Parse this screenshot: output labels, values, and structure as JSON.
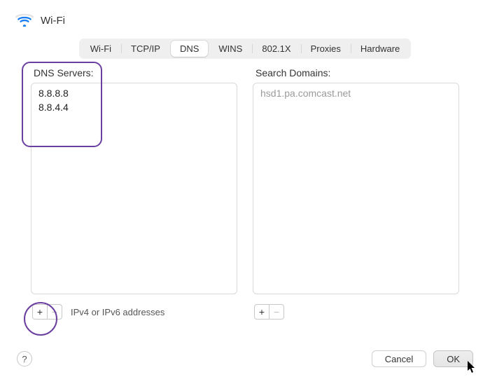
{
  "header": {
    "title": "Wi-Fi"
  },
  "tabs": {
    "items": [
      {
        "label": "Wi-Fi",
        "active": false
      },
      {
        "label": "TCP/IP",
        "active": false
      },
      {
        "label": "DNS",
        "active": true
      },
      {
        "label": "WINS",
        "active": false
      },
      {
        "label": "802.1X",
        "active": false
      },
      {
        "label": "Proxies",
        "active": false
      },
      {
        "label": "Hardware",
        "active": false
      }
    ]
  },
  "dns": {
    "label": "DNS Servers:",
    "servers": [
      "8.8.8.8",
      "8.8.4.4"
    ],
    "hint": "IPv4 or IPv6 addresses",
    "add_glyph": "+",
    "remove_glyph": "−"
  },
  "search": {
    "label": "Search Domains:",
    "placeholder_items": [
      "hsd1.pa.comcast.net"
    ],
    "add_glyph": "+",
    "remove_glyph": "−"
  },
  "footer": {
    "help": "?",
    "cancel": "Cancel",
    "ok": "OK"
  }
}
